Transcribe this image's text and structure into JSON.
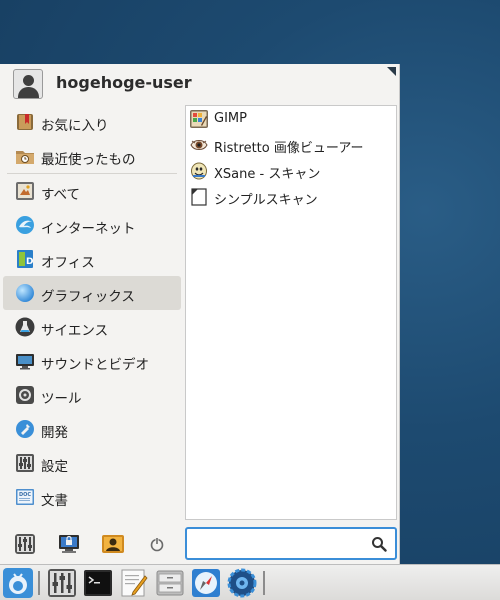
{
  "user": {
    "name": "hogehoge-user"
  },
  "categories": [
    {
      "label": "お気に入り",
      "icon": "bookmark-icon"
    },
    {
      "label": "最近使ったもの",
      "icon": "recent-folder-icon"
    },
    {
      "label": "すべて",
      "icon": "all-apps-icon"
    },
    {
      "label": "インターネット",
      "icon": "internet-icon"
    },
    {
      "label": "オフィス",
      "icon": "office-icon"
    },
    {
      "label": "グラフィックス",
      "icon": "graphics-icon",
      "selected": true
    },
    {
      "label": "サイエンス",
      "icon": "science-flask-icon"
    },
    {
      "label": "サウンドとビデオ",
      "icon": "multimedia-icon"
    },
    {
      "label": "ツール",
      "icon": "tools-icon"
    },
    {
      "label": "開発",
      "icon": "development-icon"
    },
    {
      "label": "設定",
      "icon": "settings-icon"
    },
    {
      "label": "文書",
      "icon": "documents-icon"
    }
  ],
  "apps": [
    {
      "label": "GIMP",
      "icon": "gimp-icon"
    },
    {
      "label": "Ristretto 画像ビューアー",
      "icon": "ristretto-eye-icon"
    },
    {
      "label": "XSane - スキャン",
      "icon": "xsane-icon"
    },
    {
      "label": "シンプルスキャン",
      "icon": "simple-scan-icon"
    }
  ],
  "search": {
    "value": "",
    "placeholder": ""
  },
  "colors": {
    "accent": "#3b8ed8",
    "selected_bg": "#dcdad5",
    "menu_bg": "#f4f3f1"
  }
}
